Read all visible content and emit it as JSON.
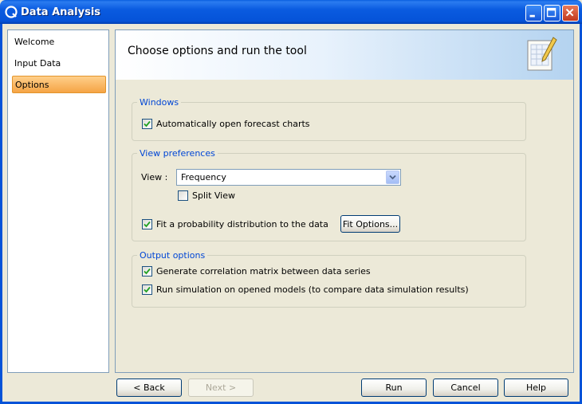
{
  "window": {
    "title": "Data Analysis"
  },
  "nav": {
    "items": [
      {
        "label": "Welcome",
        "selected": false
      },
      {
        "label": "Input Data",
        "selected": false
      },
      {
        "label": "Options",
        "selected": true
      }
    ]
  },
  "header": {
    "title": "Choose options and run the tool",
    "icon": "document-pencil-icon"
  },
  "windows_group": {
    "legend": "Windows",
    "auto_open_label": "Automatically open forecast charts",
    "auto_open_checked": true
  },
  "view_group": {
    "legend": "View preferences",
    "view_label": "View :",
    "view_value": "Frequency",
    "split_view_label": "Split View",
    "split_view_checked": false,
    "fit_label": "Fit a probability distribution to the data",
    "fit_checked": true,
    "fit_options_label": "Fit Options..."
  },
  "output_group": {
    "legend": "Output options",
    "correlation_label": "Generate correlation matrix between data series",
    "correlation_checked": true,
    "simulation_label": "Run simulation on opened models (to compare data simulation results)",
    "simulation_checked": true
  },
  "footer": {
    "back_label": "< Back",
    "next_label": "Next >",
    "run_label": "Run",
    "cancel_label": "Cancel",
    "help_label": "Help"
  },
  "colors": {
    "accent": "#0553d8",
    "legend": "#0046d5",
    "selection": "#f5a445",
    "check": "#21a121"
  }
}
